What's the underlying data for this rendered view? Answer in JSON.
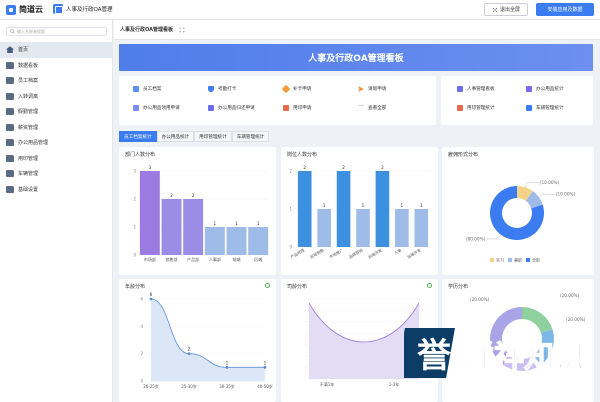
{
  "topbar": {
    "logo_text": "简道云",
    "app_name": "人事及行政OA管理",
    "exit_fullscreen": "退出全屏",
    "install_label": "安装应用及数据"
  },
  "sidebar": {
    "search_placeholder": "输入名称来搜索",
    "items": [
      {
        "label": "首页",
        "icon": "home-icon"
      },
      {
        "label": "数据看板",
        "icon": "folder-icon"
      },
      {
        "label": "员工档案",
        "icon": "folder-icon"
      },
      {
        "label": "入转调离",
        "icon": "folder-icon"
      },
      {
        "label": "假勤管理",
        "icon": "folder-icon"
      },
      {
        "label": "薪资管理",
        "icon": "folder-icon"
      },
      {
        "label": "办公用品管理",
        "icon": "folder-icon"
      },
      {
        "label": "用印管理",
        "icon": "folder-icon"
      },
      {
        "label": "车辆管理",
        "icon": "folder-icon"
      },
      {
        "label": "基础设置",
        "icon": "folder-icon"
      }
    ]
  },
  "breadcrumb": {
    "title": "人事及行政OA管理看板"
  },
  "banner": {
    "title": "人事及行政OA管理看板"
  },
  "quick_links": {
    "col1": [
      "员工档案",
      "办公用品领用申请"
    ],
    "col2": [
      "考勤打卡",
      "办公用品归还申请"
    ],
    "col3": [
      "补卡申请",
      "用印申请"
    ],
    "col4": [
      "请假申请",
      "查看全部"
    ],
    "right1": [
      "人事管理看板",
      "用印管理统计"
    ],
    "right2": [
      "办公用品统计",
      "车辆管理统计"
    ]
  },
  "colors": {
    "primary": "#3b7cf0",
    "purple": "#9b7be0",
    "lightblue": "#9fbce8"
  },
  "tabs": [
    "员工档案统计",
    "办公用品统计",
    "用印管理统计",
    "车辆管理统计"
  ],
  "charts": {
    "dept": {
      "title": "部门人数分布",
      "chart_data": {
        "type": "bar",
        "categories": [
          "市场部",
          "销售部",
          "产品部",
          "人事部",
          "前端",
          "后端"
        ],
        "values": [
          3,
          2,
          2,
          1,
          1,
          1
        ],
        "ylim": [
          0,
          3
        ]
      }
    },
    "post": {
      "title": "岗位人数分布",
      "chart_data": {
        "type": "bar",
        "categories": [
          "产品经理",
          "区域销售",
          "市场推广",
          "品牌营销",
          "前端开发",
          "人事",
          "后端开发"
        ],
        "values": [
          2,
          1,
          2,
          1,
          2,
          1,
          1
        ],
        "ylim": [
          0,
          2
        ]
      }
    },
    "employ": {
      "title": "雇佣形式分布",
      "chart_data": {
        "type": "pie",
        "labels": [
          "实习",
          "兼职",
          "全职"
        ],
        "values": [
          10,
          10,
          80
        ],
        "value_labels": [
          "(10.00%)",
          "(10.00%)",
          "(80.00%)"
        ],
        "colors": [
          "#f5d28a",
          "#9fbce8",
          "#3b7cf0"
        ]
      }
    },
    "age": {
      "title": "年龄分布",
      "chart_data": {
        "type": "area",
        "categories": [
          "26-25岁",
          "25-30岁",
          "30-35岁",
          "40-50岁"
        ],
        "values": [
          6,
          2,
          1,
          1
        ],
        "ylim": [
          0,
          6
        ]
      }
    },
    "tenure": {
      "title": "司龄分布",
      "chart_data": {
        "type": "area",
        "categories": [
          "不满1年",
          "1-3年"
        ],
        "ylim": [
          0,
          7
        ]
      }
    },
    "edu": {
      "title": "学历分布",
      "chart_data": {
        "type": "pie",
        "value_labels": [
          "(20.00%)",
          "(20.00%)",
          "(20.00%)"
        ]
      }
    }
  },
  "watermark": {
    "text": "誉祥祥知识"
  }
}
